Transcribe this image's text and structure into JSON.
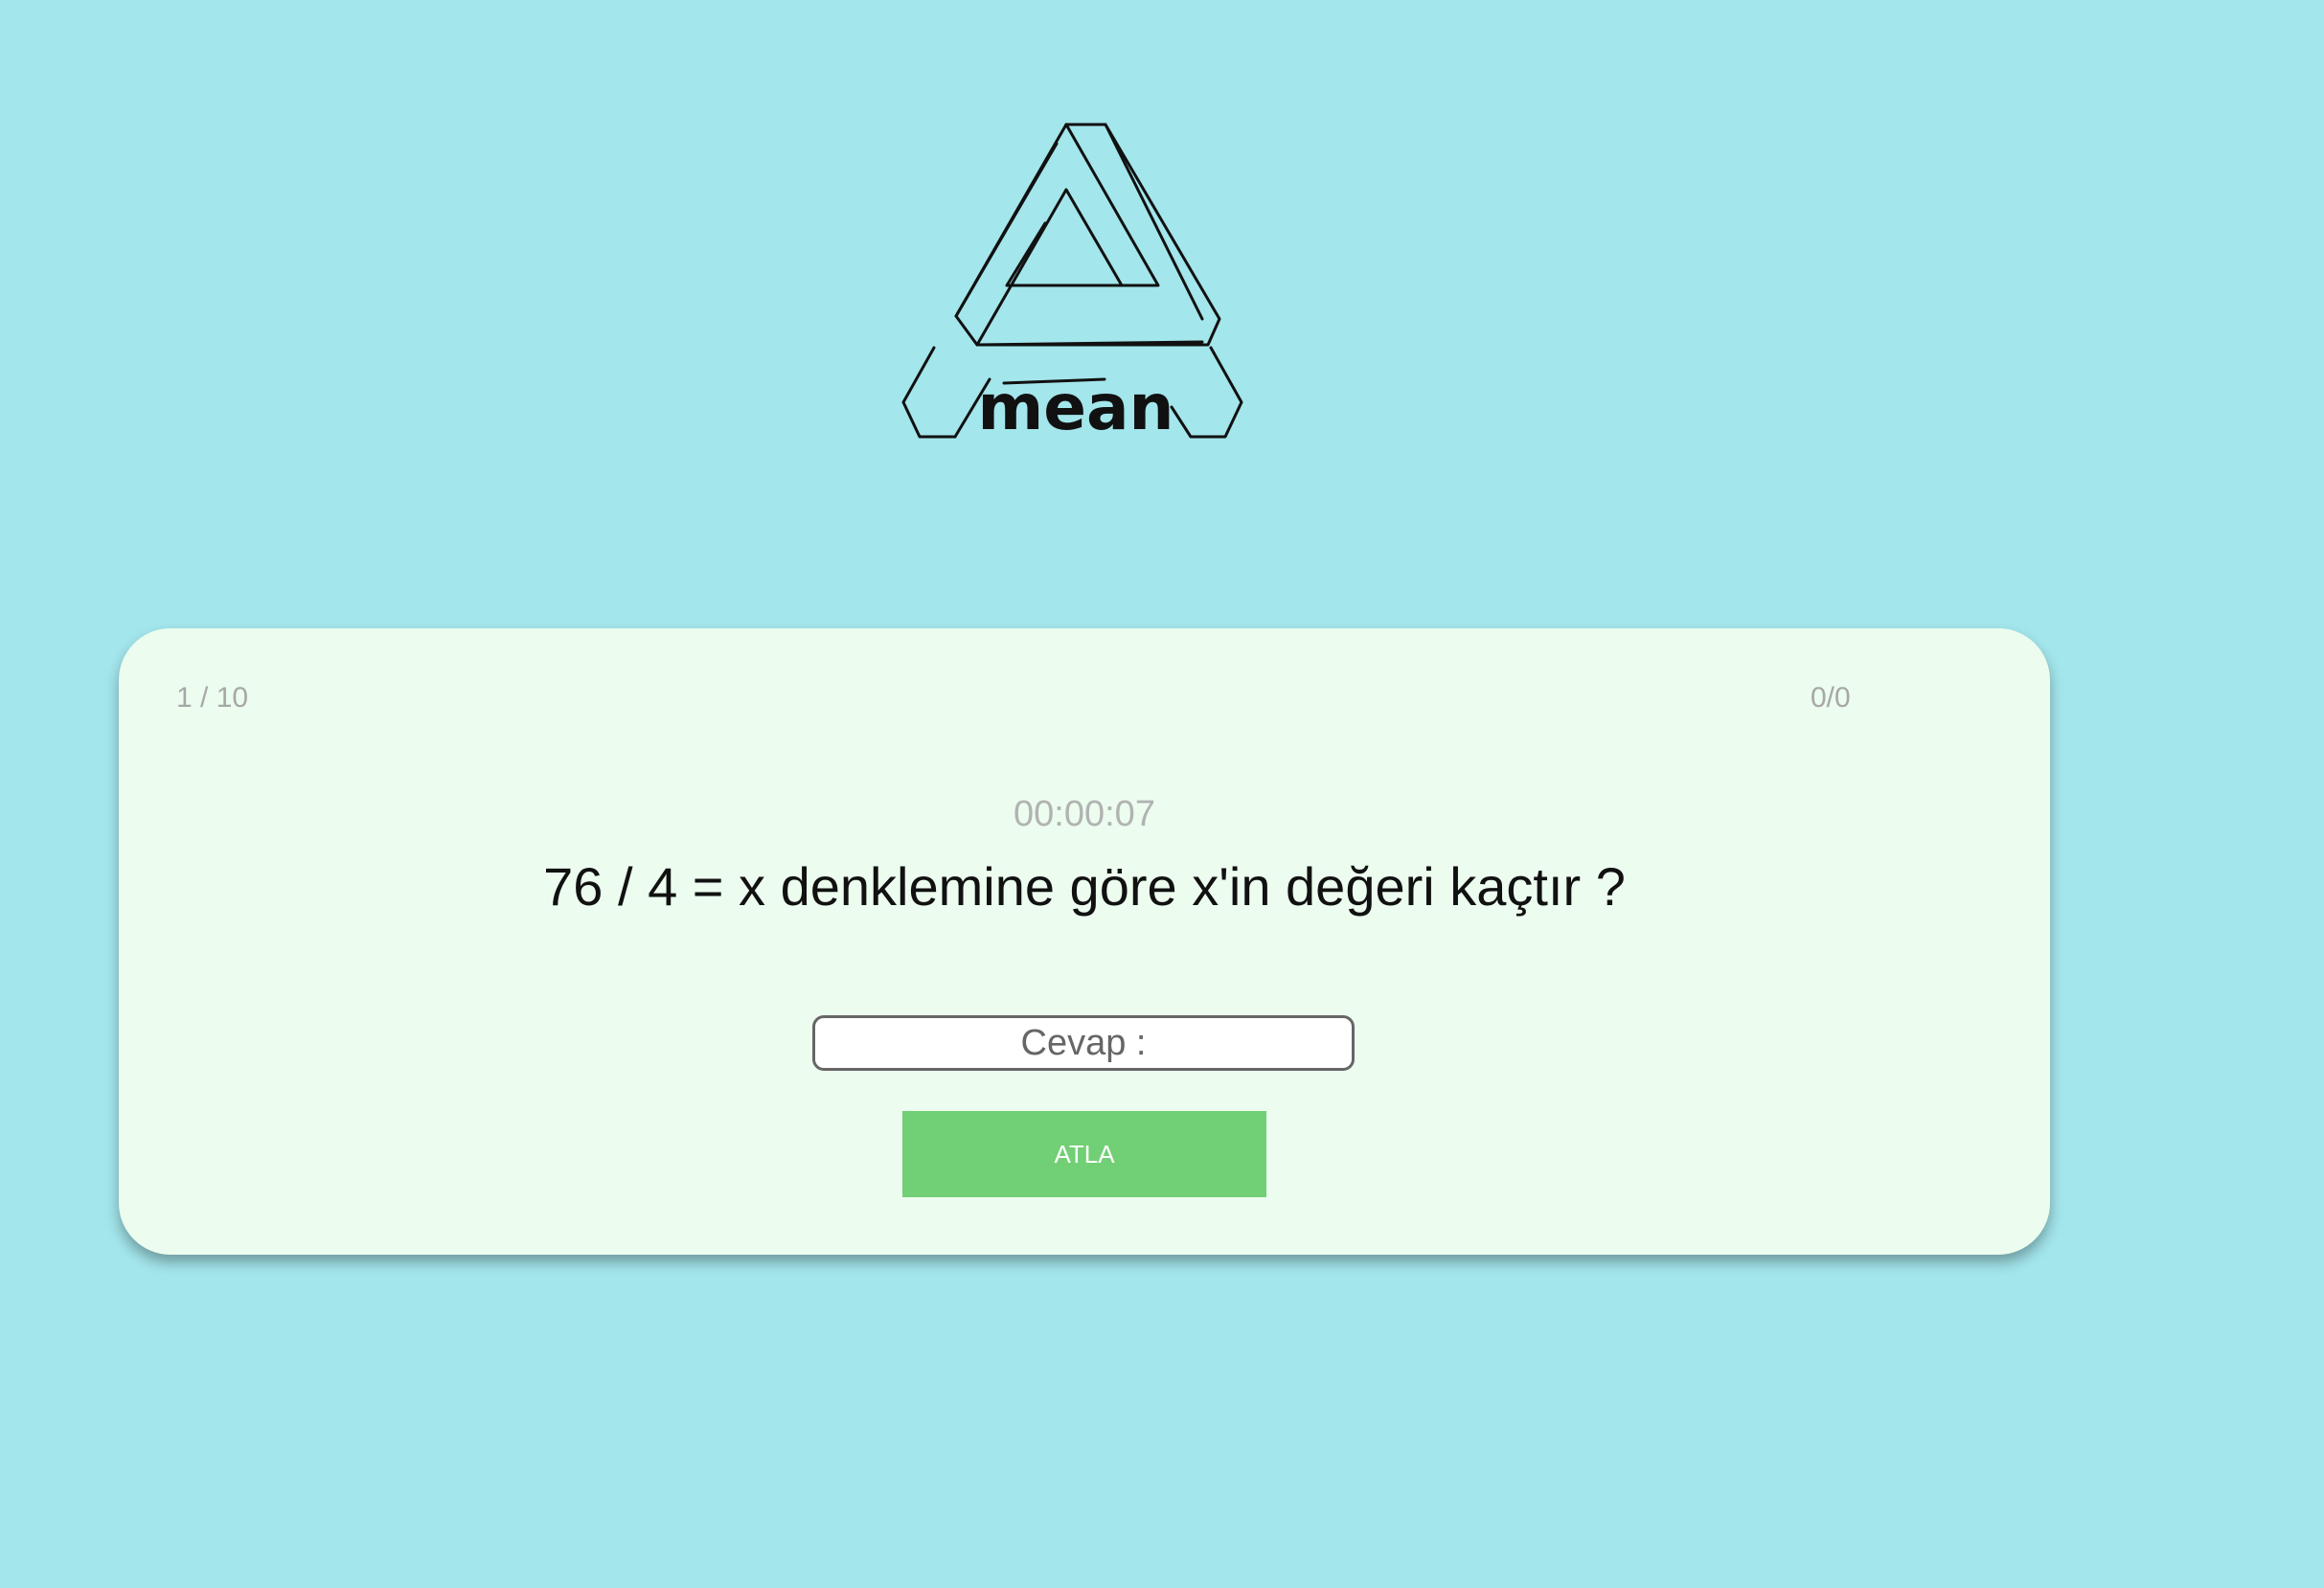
{
  "logo": {
    "text": "mean"
  },
  "quiz": {
    "counter": "1 / 10",
    "score": "0/0",
    "timer": "00:00:07",
    "question": "76 / 4 = x denklemine göre x'in değeri kaçtır ?",
    "answer_placeholder": "Cevap :",
    "answer_value": "",
    "skip_label": "ATLA"
  },
  "colors": {
    "background": "#a3e6ec",
    "card": "#ecfcef",
    "button": "#71cf75"
  }
}
